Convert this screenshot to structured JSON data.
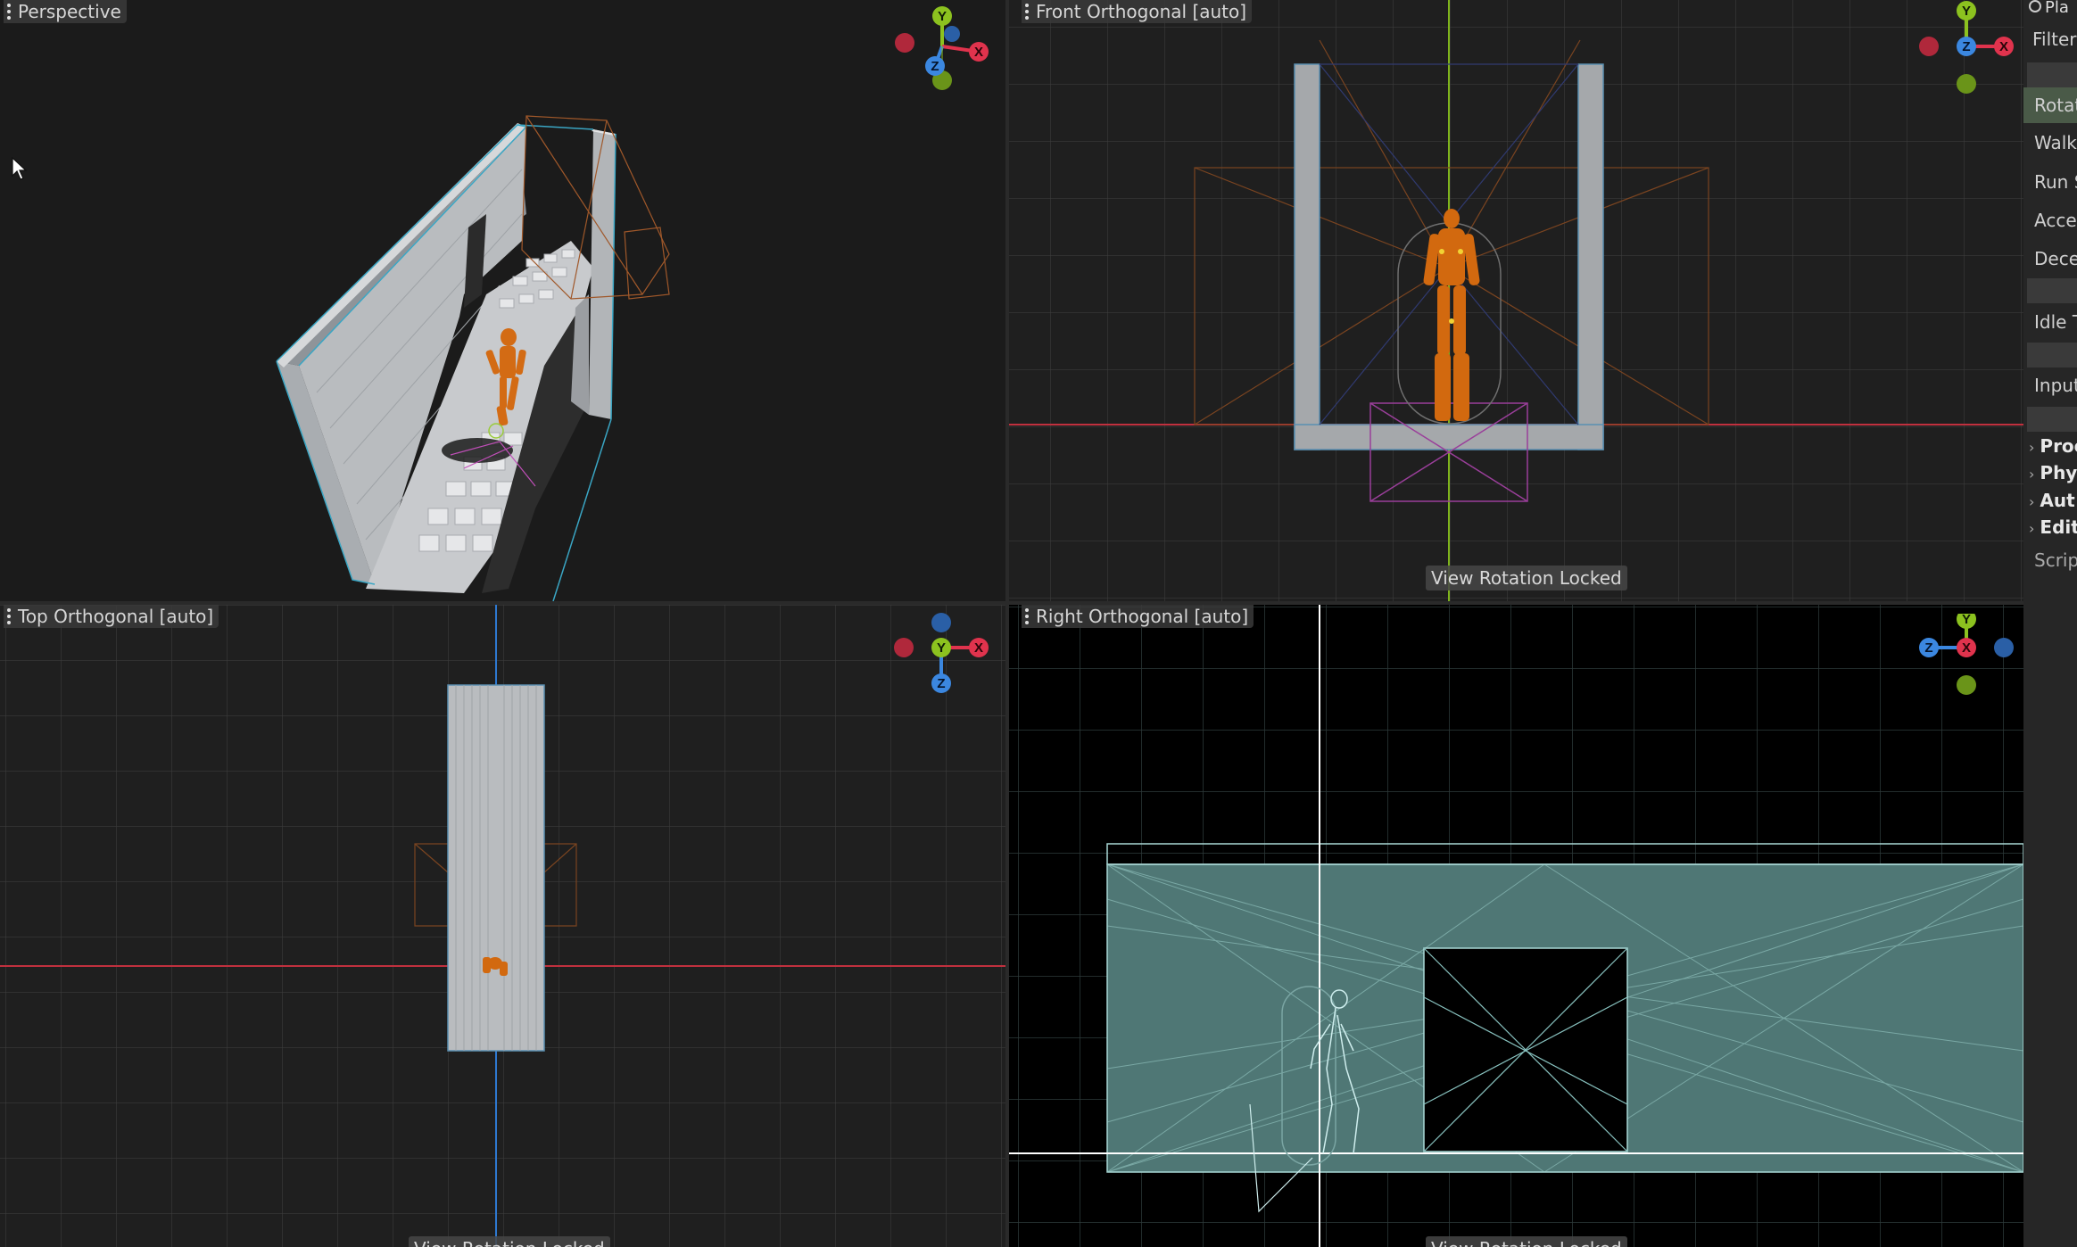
{
  "viewports": {
    "perspective": {
      "label": "Perspective"
    },
    "front": {
      "label": "Front Orthogonal [auto]",
      "status": "View Rotation Locked"
    },
    "top": {
      "label": "Top Orthogonal [auto]",
      "status": "View Rotation Locked"
    },
    "right": {
      "label": "Right Orthogonal [auto]",
      "status": "View Rotation Locked"
    }
  },
  "gizmo_axes": {
    "x": "X",
    "y": "Y",
    "z": "Z"
  },
  "axis_colors": {
    "x": "#e0334d",
    "y": "#8cc21f",
    "z": "#3b87e0"
  },
  "inspector": {
    "header": "Pla",
    "filter": "Filter",
    "properties": [
      "Rotat",
      "Walk",
      "Run S",
      "Accel",
      "Dece",
      "Idle T",
      "Input"
    ],
    "sections": [
      "Proc",
      "Phy",
      "Aut",
      "Edit"
    ],
    "footer": "Scrip"
  }
}
